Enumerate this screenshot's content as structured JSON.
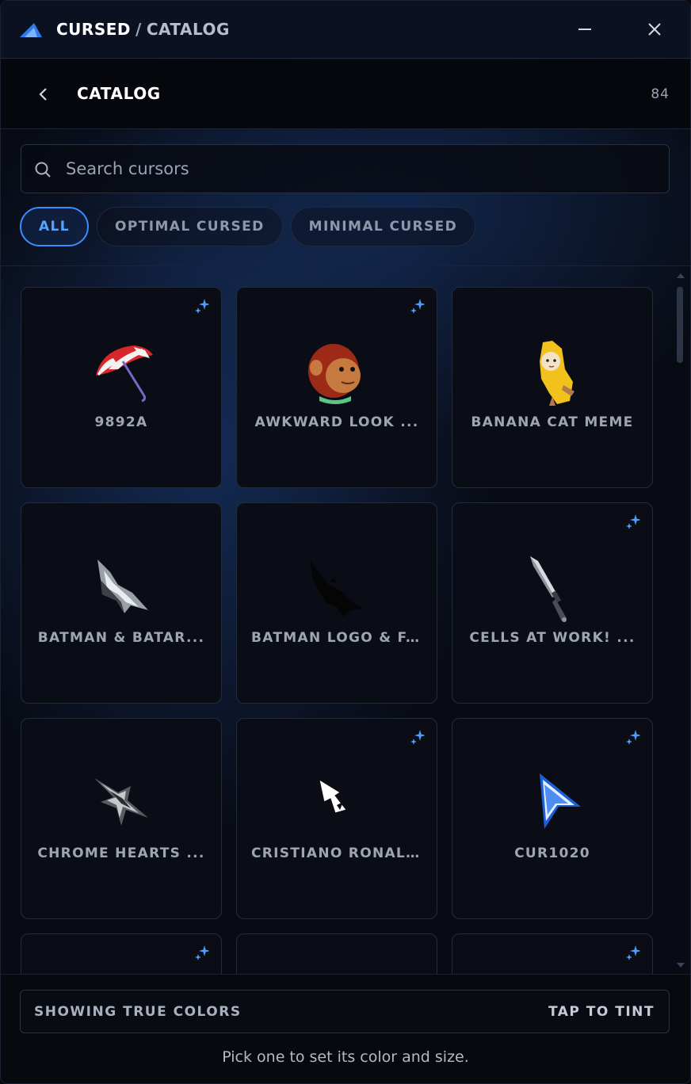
{
  "titlebar": {
    "app": "CURSED",
    "separator": "/",
    "section": "CATALOG"
  },
  "header": {
    "title": "CATALOG",
    "count": "84"
  },
  "search": {
    "placeholder": "Search cursors",
    "value": ""
  },
  "filters": [
    {
      "label": "ALL",
      "active": true
    },
    {
      "label": "OPTIMAL CURSED",
      "active": false
    },
    {
      "label": "MINIMAL CURSED",
      "active": false
    }
  ],
  "items": [
    {
      "label": "9892A",
      "art": "umbrella-icon",
      "sparkle": true
    },
    {
      "label": "AWKWARD LOOK ...",
      "art": "monkey-icon",
      "sparkle": true
    },
    {
      "label": "BANANA CAT MEME",
      "art": "banana-cat-icon",
      "sparkle": false
    },
    {
      "label": "BATMAN & BATAR...",
      "art": "batarang-icon",
      "sparkle": false
    },
    {
      "label": "BATMAN LOGO & F...",
      "art": "bat-icon",
      "sparkle": false
    },
    {
      "label": "CELLS AT WORK! ...",
      "art": "knife-icon",
      "sparkle": true
    },
    {
      "label": "CHROME HEARTS ...",
      "art": "chrome-cross-icon",
      "sparkle": false
    },
    {
      "label": "CRISTIANO RONAL...",
      "art": "si-arrow-icon",
      "sparkle": true
    },
    {
      "label": "CUR1020",
      "art": "blue-arrow-icon",
      "sparkle": true
    },
    {
      "label": "",
      "art": "",
      "sparkle": true
    },
    {
      "label": "",
      "art": "",
      "sparkle": false
    },
    {
      "label": "",
      "art": "",
      "sparkle": true
    }
  ],
  "footer": {
    "status": "SHOWING TRUE COLORS",
    "action": "TAP TO TINT",
    "hint": "Pick one to set its color and size."
  },
  "colors": {
    "accent": "#3b8cff",
    "sparkle": "#4ea0ff",
    "card_bg": "#0a0d15"
  }
}
